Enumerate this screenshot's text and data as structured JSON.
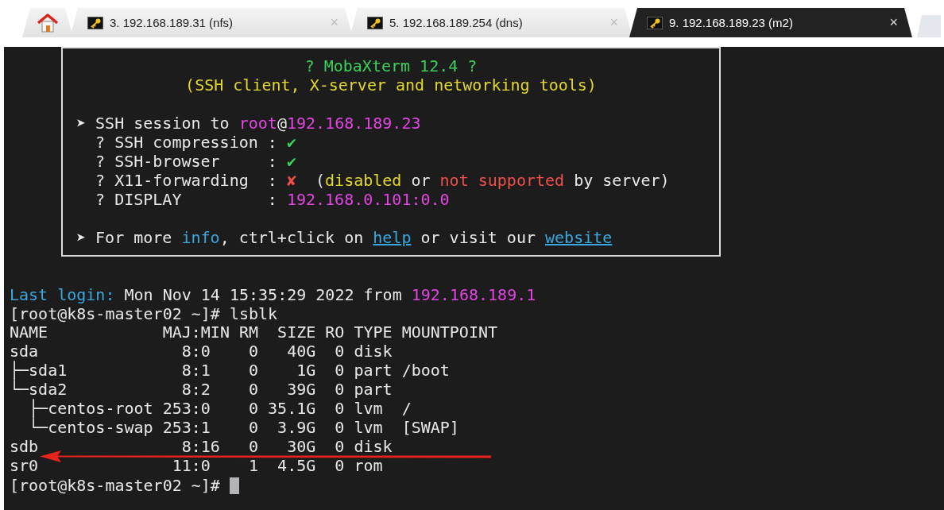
{
  "tabs": [
    {
      "kind": "home",
      "selected": false
    },
    {
      "kind": "session",
      "label": "3. 192.168.189.31 (nfs)",
      "close": "×",
      "selected": false
    },
    {
      "kind": "session",
      "label": "5. 192.168.189.254 (dns)",
      "close": "×",
      "selected": false
    },
    {
      "kind": "session",
      "label": "9. 192.168.189.23 (m2)",
      "close": "×",
      "selected": true
    }
  ],
  "terminal": {
    "banner": [
      {
        "kind": "title",
        "segments": [
          {
            "text": "? MobaXterm 12.4 ?",
            "color": "#3ad15a"
          }
        ]
      },
      {
        "kind": "title",
        "segments": [
          {
            "text": "(SSH client, X-server and networking tools)",
            "color": "#e3d82a"
          }
        ]
      },
      {
        "kind": "blank"
      },
      {
        "kind": "text",
        "segments": [
          {
            "text": "➤ SSH session to "
          },
          {
            "text": "root",
            "color": "#e444e4"
          },
          {
            "text": "@"
          },
          {
            "text": "192.168.189.23",
            "color": "#e444e4"
          }
        ]
      },
      {
        "kind": "text",
        "segments": [
          {
            "text": "  ? SSH compression : "
          },
          {
            "text": "✔",
            "color": "#3ad15a"
          }
        ]
      },
      {
        "kind": "text",
        "segments": [
          {
            "text": "  ? SSH-browser     : "
          },
          {
            "text": "✔",
            "color": "#3ad15a"
          }
        ]
      },
      {
        "kind": "text",
        "segments": [
          {
            "text": "  ? X11-forwarding  : "
          },
          {
            "text": "✘",
            "color": "#f0504a"
          },
          {
            "text": "  ("
          },
          {
            "text": "disabled",
            "color": "#e3d82a"
          },
          {
            "text": " or "
          },
          {
            "text": "not supported",
            "color": "#f0504a"
          },
          {
            "text": " by server)"
          }
        ]
      },
      {
        "kind": "text",
        "segments": [
          {
            "text": "  ? DISPLAY         : "
          },
          {
            "text": "192.168.0.101:0.0",
            "color": "#e444e4"
          }
        ]
      },
      {
        "kind": "blank"
      },
      {
        "kind": "text",
        "segments": [
          {
            "text": "➤ For more "
          },
          {
            "text": "info",
            "color": "#38a8e0"
          },
          {
            "text": ", ctrl+click on "
          },
          {
            "text": "help",
            "color": "#38a8e0",
            "kind": "link"
          },
          {
            "text": " or visit our "
          },
          {
            "text": "website",
            "color": "#38a8e0",
            "kind": "link"
          }
        ]
      }
    ],
    "lines": [
      {
        "kind": "blank"
      },
      {
        "kind": "text",
        "segments": [
          {
            "text": "Last login:",
            "color": "#38a8e0"
          },
          {
            "text": " Mon Nov 14 15:35:29 2022 from "
          },
          {
            "text": "192.168.189.1",
            "color": "#e444e4"
          }
        ]
      },
      {
        "kind": "text",
        "segments": [
          {
            "text": "[root@k8s-master02 ~]# lsblk"
          }
        ]
      },
      {
        "kind": "table"
      },
      {
        "kind": "prompt",
        "segments": [
          {
            "text": "[root@k8s-master02 ~]#"
          }
        ]
      }
    ],
    "table": {
      "columns": [
        "NAME",
        "MAJ:MIN",
        "RM",
        "SIZE",
        "RO",
        "TYPE",
        "MOUNTPOINT"
      ],
      "rows": [
        {
          "cells": [
            "sda",
            "8:0",
            "0",
            "40G",
            "0",
            "disk"
          ],
          "children": [
            {
              "cells": [
                "├─sda1",
                "8:1",
                "0",
                "1G",
                "0",
                "part",
                "/boot"
              ]
            },
            {
              "cells": [
                "└─sda2",
                "8:2",
                "0",
                "39G",
                "0",
                "part"
              ],
              "children": [
                {
                  "cells": [
                    "├─centos-root",
                    "253:0",
                    "0",
                    "35.1G",
                    "0",
                    "lvm",
                    "/"
                  ]
                },
                {
                  "cells": [
                    "└─centos-swap",
                    "253:1",
                    "0",
                    "3.9G",
                    "0",
                    "lvm",
                    "[SWAP]"
                  ]
                }
              ]
            }
          ]
        },
        {
          "cells": [
            "sdb",
            "8:16",
            "0",
            "30G",
            "0",
            "disk"
          ]
        },
        {
          "cells": [
            "sr0",
            "11:0",
            "1",
            "4.5G",
            "0",
            "rom"
          ]
        }
      ]
    }
  }
}
